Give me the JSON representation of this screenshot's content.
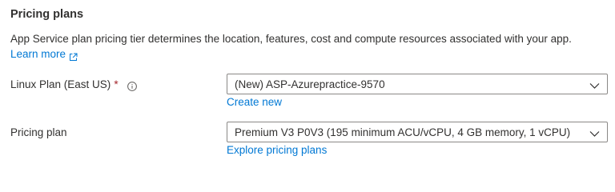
{
  "section": {
    "title": "Pricing plans",
    "description": "App Service plan pricing tier determines the location, features, cost and compute resources associated with your app.",
    "learn_more": "Learn more"
  },
  "linux_plan": {
    "label": "Linux Plan (East US)",
    "required_marker": "*",
    "selected_value": "(New) ASP-Azurepractice-9570",
    "create_link": "Create new"
  },
  "pricing_plan": {
    "label": "Pricing plan",
    "selected_value": "Premium V3 P0V3 (195 minimum ACU/vCPU, 4 GB memory, 1 vCPU)",
    "explore_link": "Explore pricing plans"
  },
  "icons": {
    "info": "info-icon",
    "external_link": "external-link-icon",
    "dropdown": "chevron-down-icon"
  },
  "colors": {
    "link": "#0078d4",
    "required": "#a4262c",
    "text": "#323130",
    "border": "#8a8886"
  }
}
